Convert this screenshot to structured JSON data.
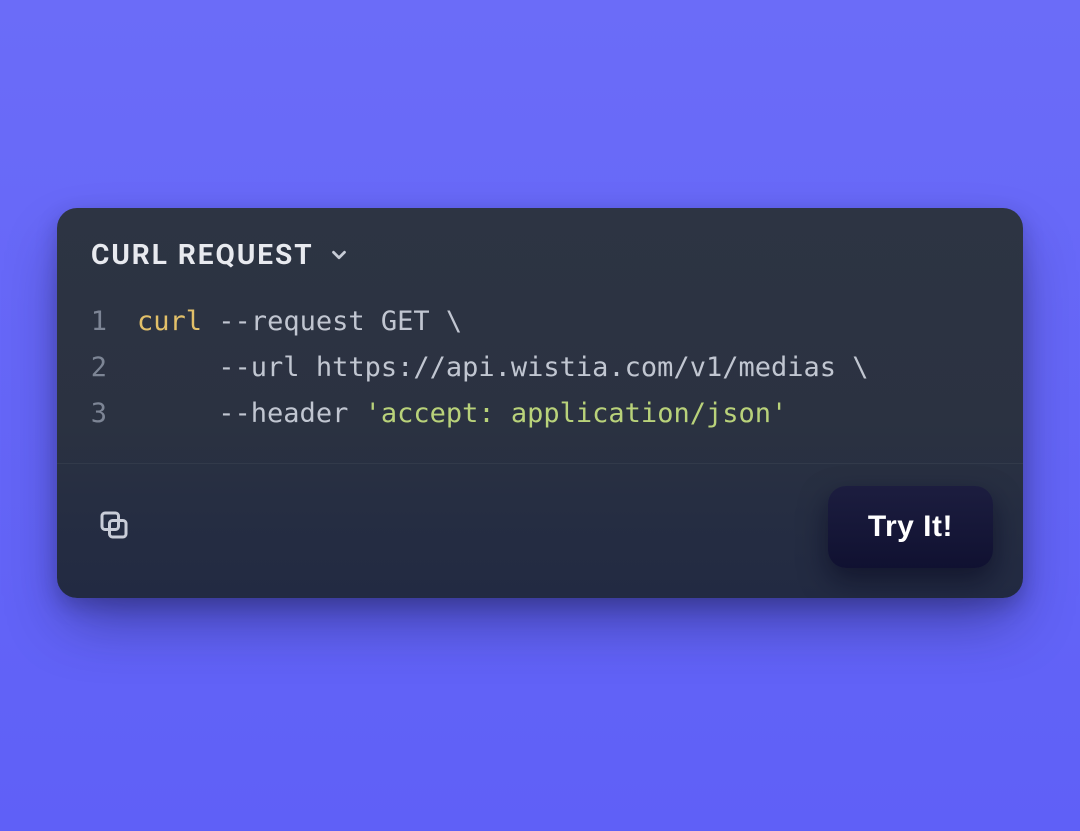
{
  "header": {
    "title": "CURL REQUEST"
  },
  "code": {
    "lines": [
      {
        "n": "1",
        "segments": [
          {
            "cls": "tok-cmd",
            "t": "curl"
          },
          {
            "cls": "tok-plain",
            "t": " "
          },
          {
            "cls": "tok-flag",
            "t": "--request"
          },
          {
            "cls": "tok-plain",
            "t": " GET "
          },
          {
            "cls": "tok-sym",
            "t": "\\"
          }
        ]
      },
      {
        "n": "2",
        "segments": [
          {
            "cls": "tok-plain",
            "t": "     "
          },
          {
            "cls": "tok-flag",
            "t": "--url"
          },
          {
            "cls": "tok-plain",
            "t": " https://api.wistia.com/v1/medias "
          },
          {
            "cls": "tok-sym",
            "t": "\\"
          }
        ]
      },
      {
        "n": "3",
        "segments": [
          {
            "cls": "tok-plain",
            "t": "     "
          },
          {
            "cls": "tok-flag",
            "t": "--header"
          },
          {
            "cls": "tok-plain",
            "t": " "
          },
          {
            "cls": "tok-str",
            "t": "'accept: application/json'"
          }
        ]
      }
    ]
  },
  "footer": {
    "try_label": "Try It!"
  }
}
